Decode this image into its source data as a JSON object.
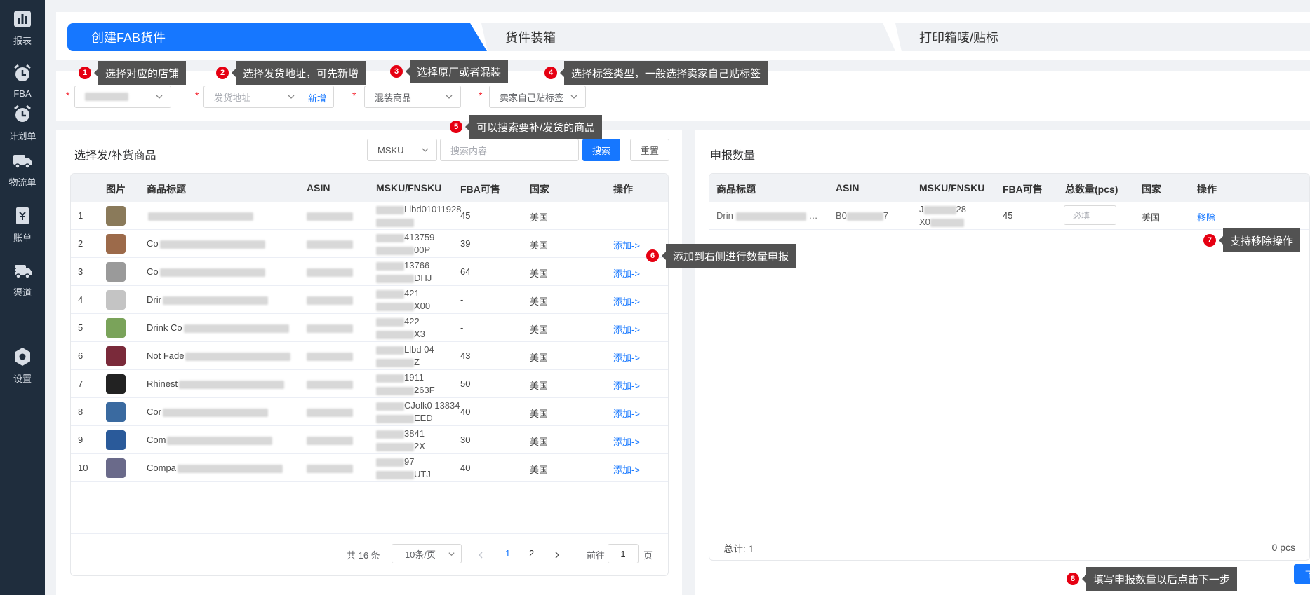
{
  "sidebar": {
    "items": [
      {
        "label": "报表",
        "icon": "bar-chart-icon"
      },
      {
        "label": "FBA",
        "icon": "alarm-clock-icon"
      },
      {
        "label": "计划单",
        "icon": "alarm-clock-icon"
      },
      {
        "label": "物流单",
        "icon": "truck-icon"
      },
      {
        "label": "账单",
        "icon": "bill-icon"
      },
      {
        "label": "渠道",
        "icon": "truck-fast-icon"
      },
      {
        "label": "设置",
        "icon": "hexagon-gear-icon"
      }
    ]
  },
  "steps": [
    "创建FAB货件",
    "货件装箱",
    "打印箱唛/贴标"
  ],
  "filters": {
    "shop_value": "",
    "address_placeholder": "发货地址",
    "address_add": "新增",
    "mix_value": "混装商品",
    "label_value": "卖家自己贴标签"
  },
  "callouts": [
    {
      "num": "1",
      "text": "选择对应的店铺"
    },
    {
      "num": "2",
      "text": "选择发货地址，可先新增"
    },
    {
      "num": "3",
      "text": "选择原厂或者混装"
    },
    {
      "num": "4",
      "text": "选择标签类型，一般选择卖家自己贴标签"
    },
    {
      "num": "5",
      "text": "可以搜索要补/发货的商品"
    },
    {
      "num": "6",
      "text": "添加到右侧进行数量申报"
    },
    {
      "num": "7",
      "text": "支持移除操作"
    },
    {
      "num": "8",
      "text": "填写申报数量以后点击下一步"
    }
  ],
  "left": {
    "title": "选择发/补货商品",
    "search_field": "MSKU",
    "search_placeholder": "搜索内容",
    "search_btn": "搜索",
    "reset_btn": "重置",
    "columns": [
      "图片",
      "商品标题",
      "ASIN",
      "MSKU/FNSKU",
      "FBA可售",
      "国家",
      "操作"
    ],
    "rows": [
      {
        "idx": "1",
        "title": "",
        "msku1": "Llbd01011928",
        "msku2": "",
        "fba": "45",
        "country": "美国",
        "op": ""
      },
      {
        "idx": "2",
        "title": "Co",
        "msku1": "413759",
        "msku2": "00P",
        "fba": "39",
        "country": "美国",
        "op": "添加->"
      },
      {
        "idx": "3",
        "title": "Co",
        "msku1": "13766",
        "msku2": "DHJ",
        "fba": "64",
        "country": "美国",
        "op": "添加->"
      },
      {
        "idx": "4",
        "title": "Drir",
        "msku1": "421",
        "msku2": "X00",
        "fba": "-",
        "country": "美国",
        "op": "添加->"
      },
      {
        "idx": "5",
        "title": "Drink Co",
        "msku1": "422",
        "msku2": "X3",
        "fba": "-",
        "country": "美国",
        "op": "添加->"
      },
      {
        "idx": "6",
        "title": "Not Fade",
        "msku1": "Llbd 04",
        "msku2": "Z",
        "fba": "43",
        "country": "美国",
        "op": "添加->"
      },
      {
        "idx": "7",
        "title": "Rhinest",
        "msku1": "1911",
        "msku2": "263F",
        "fba": "50",
        "country": "美国",
        "op": "添加->"
      },
      {
        "idx": "8",
        "title": "Cor",
        "msku1": "CJolk0 13834",
        "msku2": "EED",
        "fba": "40",
        "country": "美国",
        "op": "添加->"
      },
      {
        "idx": "9",
        "title": "Com",
        "msku1": "3841",
        "msku2": "2X",
        "fba": "30",
        "country": "美国",
        "op": "添加->"
      },
      {
        "idx": "10",
        "title": "Compa",
        "msku1": "97",
        "msku2": "UTJ",
        "fba": "40",
        "country": "美国",
        "op": "添加->"
      }
    ],
    "pager": {
      "total": "共 16 条",
      "page_size": "10条/页",
      "pages": [
        "1",
        "2"
      ],
      "goto_prefix": "前往",
      "goto_value": "1",
      "goto_suffix": "页"
    }
  },
  "right": {
    "title": "申报数量",
    "columns": [
      "商品标题",
      "ASIN",
      "MSKU/FNSKU",
      "FBA可售",
      "总数量(pcs)",
      "国家",
      "操作"
    ],
    "rows": [
      {
        "title": "Drin",
        "asin_pre": "B0",
        "asin_post": "7",
        "msku1": "J",
        "msku1b": "28",
        "msku2": "X0",
        "fba": "45",
        "qty_placeholder": "必填",
        "country": "美国",
        "op": "移除"
      }
    ],
    "total_label": "总计: 1",
    "total_pcs": "0 pcs",
    "next_btn": "下一步"
  }
}
